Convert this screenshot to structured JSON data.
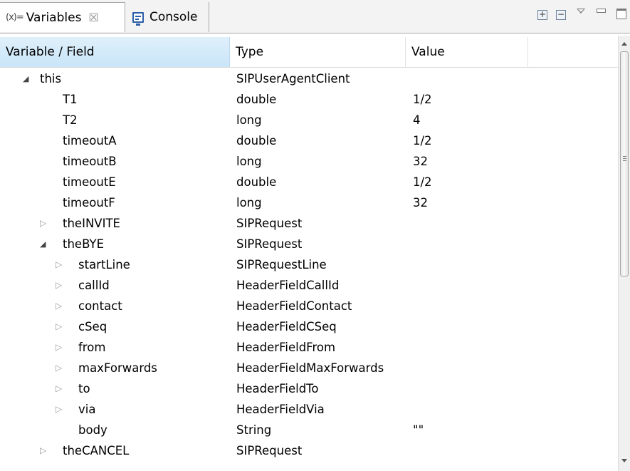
{
  "tabs": [
    {
      "icon": "(x)=",
      "label": "Variables",
      "close": "☒"
    },
    {
      "label": "Console"
    }
  ],
  "toolbar": {
    "expand_all": "+",
    "collapse_all": "−"
  },
  "columns": [
    "Variable / Field",
    "Type",
    "Value"
  ],
  "rows": [
    {
      "name": "this",
      "type": "SIPUserAgentClient",
      "value": "",
      "level": 0,
      "state": "expanded"
    },
    {
      "name": "T1",
      "type": "double",
      "value": "1/2",
      "level": 1,
      "state": "leaf"
    },
    {
      "name": "T2",
      "type": "long",
      "value": "4",
      "level": 1,
      "state": "leaf"
    },
    {
      "name": "timeoutA",
      "type": "double",
      "value": "1/2",
      "level": 1,
      "state": "leaf"
    },
    {
      "name": "timeoutB",
      "type": "long",
      "value": "32",
      "level": 1,
      "state": "leaf"
    },
    {
      "name": "timeoutE",
      "type": "double",
      "value": "1/2",
      "level": 1,
      "state": "leaf"
    },
    {
      "name": "timeoutF",
      "type": "long",
      "value": "32",
      "level": 1,
      "state": "leaf"
    },
    {
      "name": "theINVITE",
      "type": "SIPRequest",
      "value": "",
      "level": 1,
      "state": "collapsed"
    },
    {
      "name": "theBYE",
      "type": "SIPRequest",
      "value": "",
      "level": 1,
      "state": "expanded"
    },
    {
      "name": "startLine",
      "type": "SIPRequestLine",
      "value": "",
      "level": 2,
      "state": "collapsed"
    },
    {
      "name": "callId",
      "type": "HeaderFieldCallId",
      "value": "",
      "level": 2,
      "state": "collapsed"
    },
    {
      "name": "contact",
      "type": "HeaderFieldContact",
      "value": "",
      "level": 2,
      "state": "collapsed"
    },
    {
      "name": "cSeq",
      "type": "HeaderFieldCSeq",
      "value": "",
      "level": 2,
      "state": "collapsed"
    },
    {
      "name": "from",
      "type": "HeaderFieldFrom",
      "value": "",
      "level": 2,
      "state": "collapsed"
    },
    {
      "name": "maxForwards",
      "type": "HeaderFieldMaxForwards",
      "value": "",
      "level": 2,
      "state": "collapsed"
    },
    {
      "name": "to",
      "type": "HeaderFieldTo",
      "value": "",
      "level": 2,
      "state": "collapsed"
    },
    {
      "name": "via",
      "type": "HeaderFieldVia",
      "value": "",
      "level": 2,
      "state": "collapsed"
    },
    {
      "name": "body",
      "type": "String",
      "value": "\"\"",
      "level": 2,
      "state": "leaf"
    },
    {
      "name": "theCANCEL",
      "type": "SIPRequest",
      "value": "",
      "level": 1,
      "state": "collapsed"
    }
  ],
  "icons": {
    "expanded": "◢",
    "collapsed": "▷",
    "view_menu": "chevron-down-icon",
    "minimize": "minimize-icon",
    "maximize": "maximize-icon"
  },
  "colors": {
    "selected_header": "#cde6f7",
    "console_icon": "#2b5ea8"
  }
}
